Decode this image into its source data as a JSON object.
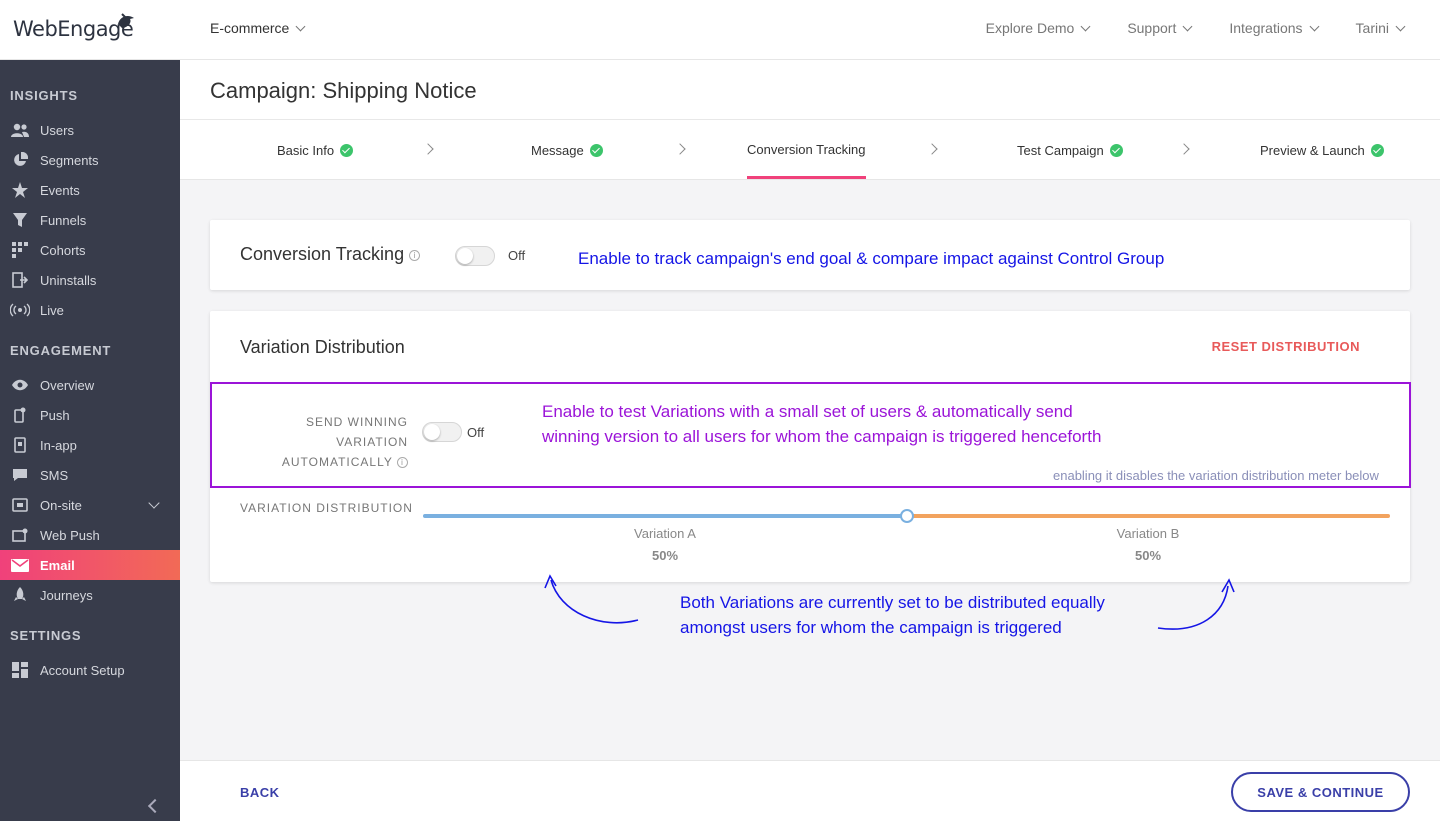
{
  "app": {
    "logo": "WebEngage",
    "workspace": "E-commerce"
  },
  "topnav": [
    "Explore Demo",
    "Support",
    "Integrations",
    "Tarini"
  ],
  "sidebar": {
    "insights_title": "INSIGHTS",
    "insights": [
      {
        "label": "Users",
        "icon": "users-icon"
      },
      {
        "label": "Segments",
        "icon": "pie-icon"
      },
      {
        "label": "Events",
        "icon": "star-icon"
      },
      {
        "label": "Funnels",
        "icon": "funnel-icon"
      },
      {
        "label": "Cohorts",
        "icon": "grid-icon"
      },
      {
        "label": "Uninstalls",
        "icon": "exit-icon"
      },
      {
        "label": "Live",
        "icon": "broadcast-icon"
      }
    ],
    "engagement_title": "ENGAGEMENT",
    "engagement": [
      {
        "label": "Overview",
        "icon": "eye-icon"
      },
      {
        "label": "Push",
        "icon": "phone-icon"
      },
      {
        "label": "In-app",
        "icon": "phone-square-icon"
      },
      {
        "label": "SMS",
        "icon": "chat-icon"
      },
      {
        "label": "On-site",
        "icon": "window-icon"
      },
      {
        "label": "Web Push",
        "icon": "browser-icon"
      },
      {
        "label": "Email",
        "icon": "mail-icon"
      },
      {
        "label": "Journeys",
        "icon": "rocket-icon"
      }
    ],
    "settings_title": "SETTINGS",
    "settings": [
      {
        "label": "Account Setup",
        "icon": "dashboard-icon"
      }
    ]
  },
  "page": {
    "title": "Campaign: Shipping Notice"
  },
  "steps": [
    {
      "label": "Basic Info",
      "done": true
    },
    {
      "label": "Message",
      "done": true
    },
    {
      "label": "Conversion Tracking",
      "done": false
    },
    {
      "label": "Test Campaign",
      "done": true
    },
    {
      "label": "Preview & Launch",
      "done": true
    }
  ],
  "conversion": {
    "label": "Conversion Tracking",
    "toggle_state": "Off",
    "annotation": "Enable to track campaign's end goal & compare impact against Control Group"
  },
  "variation": {
    "title": "Variation Distribution",
    "reset_label": "RESET DISTRIBUTION",
    "send_winning_lines": [
      "SEND WINNING",
      "VARIATION",
      "AUTOMATICALLY"
    ],
    "send_winning_state": "Off",
    "annotation_line1": "Enable to test Variations with a small set of users & automatically send",
    "annotation_line2": "winning version to all users for whom the campaign is triggered henceforth",
    "annotation_note": "enabling it disables the variation distribution meter below",
    "distribution_label": "VARIATION DISTRIBUTION",
    "variations": [
      {
        "name": "Variation A",
        "percent": "50%",
        "value": 50,
        "color": "#7ab0e0"
      },
      {
        "name": "Variation B",
        "percent": "50%",
        "value": 50,
        "color": "#f2a35e"
      }
    ],
    "bottom_annotation_line1": "Both Variations are currently set to be distributed equally",
    "bottom_annotation_line2": "amongst users for whom the campaign is triggered"
  },
  "footer": {
    "back": "BACK",
    "save": "SAVE & CONTINUE"
  },
  "colors": {
    "accent": "#f0417b",
    "primary": "#3a3fa8",
    "annotation_blue": "#1515e6",
    "annotation_purple": "#9b14d8",
    "reset": "#e85a5a"
  }
}
